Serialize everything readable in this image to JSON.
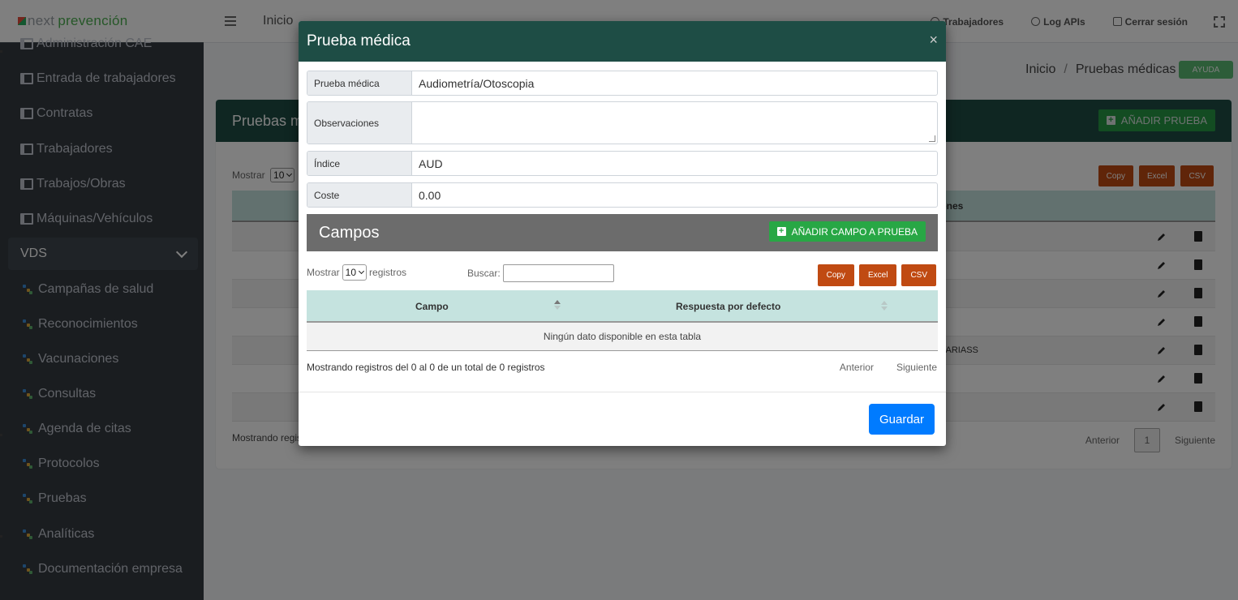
{
  "brand": {
    "part1": "next",
    "part2": "prevención"
  },
  "sidebar": {
    "items": [
      {
        "label": "Administración CAE"
      },
      {
        "label": "Entrada de trabajadores"
      },
      {
        "label": "Contratas"
      },
      {
        "label": "Trabajadores"
      },
      {
        "label": "Trabajos/Obras"
      },
      {
        "label": "Máquinas/Vehículos"
      }
    ],
    "group": {
      "label": "VDS"
    },
    "subitems": [
      {
        "label": "Campañas de salud"
      },
      {
        "label": "Reconocimientos"
      },
      {
        "label": "Vacunaciones"
      },
      {
        "label": "Consultas"
      },
      {
        "label": "Agenda de citas"
      },
      {
        "label": "Protocolos"
      },
      {
        "label": "Pruebas"
      },
      {
        "label": "Analíticas"
      },
      {
        "label": "Documentación empresa"
      }
    ]
  },
  "topbar": {
    "home": "Inicio",
    "links": [
      "Trabajadores",
      "Log APIs",
      "Cerrar sesión"
    ]
  },
  "breadcrumb": {
    "home": "Inicio",
    "sep": "/",
    "current": "Pruebas médicas"
  },
  "help_label": "AYUDA",
  "page": {
    "card_title": "Pruebas mé",
    "add_test": "AÑADIR PRUEBA",
    "show_label": "Mostrar",
    "show_value": "10",
    "export": [
      "Copy",
      "Excel",
      "CSV"
    ],
    "col_partial": "iones",
    "row_partial": "VARIASS",
    "footer_partial": "Mostrando regis",
    "pager": {
      "prev": "Anterior",
      "page": "1",
      "next": "Siguiente"
    }
  },
  "modal": {
    "title": "Prueba médica",
    "close": "×",
    "fields": [
      {
        "label": "Prueba médica",
        "value": "Audiometría/Otoscopia"
      },
      {
        "label": "Observaciones",
        "value": ""
      },
      {
        "label": "Índice",
        "value": "AUD"
      },
      {
        "label": "Coste",
        "value": "0.00"
      }
    ],
    "section_title": "Campos",
    "add_field": "AÑADIR CAMPO A PRUEBA",
    "show_label": "Mostrar",
    "show_value": "10",
    "records_label": "registros",
    "search_label": "Buscar:",
    "export": [
      "Copy",
      "Excel",
      "CSV"
    ],
    "columns": [
      "Campo",
      "Respuesta por defecto"
    ],
    "empty": "Ningún dato disponible en esta tabla",
    "info": "Mostrando registros del 0 al 0 de un total de 0 registros",
    "prev": "Anterior",
    "next": "Siguiente",
    "save": "Guardar"
  },
  "colors": {
    "header": "#1e4d45",
    "accent_green": "#28a745",
    "export": "#c04a12",
    "save": "#007bff"
  }
}
